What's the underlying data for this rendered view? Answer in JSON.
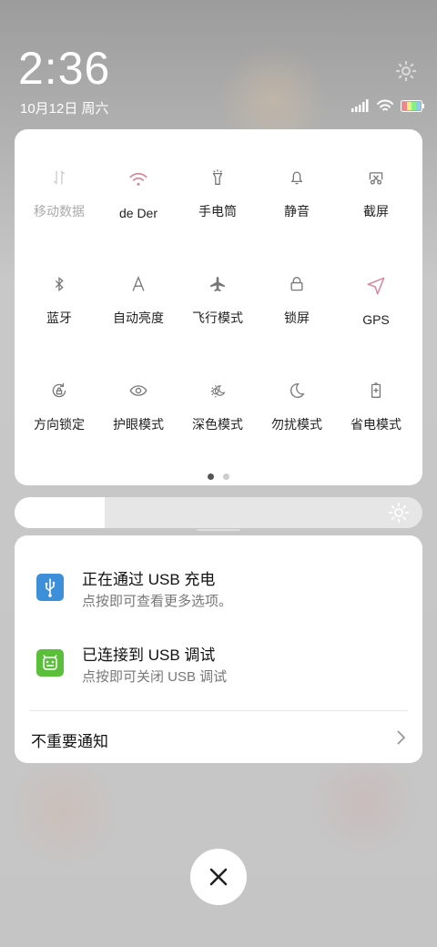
{
  "status": {
    "time": "2:36",
    "date": "10月12日 周六"
  },
  "quick_settings": {
    "tiles": [
      {
        "label": "移动数据",
        "icon": "mobile-data-icon",
        "state": "off"
      },
      {
        "label": "de     Der",
        "icon": "wifi-icon",
        "state": "on"
      },
      {
        "label": "手电筒",
        "icon": "flashlight-icon",
        "state": "off"
      },
      {
        "label": "静音",
        "icon": "bell-icon",
        "state": "off"
      },
      {
        "label": "截屏",
        "icon": "screenshot-icon",
        "state": "off"
      },
      {
        "label": "蓝牙",
        "icon": "bluetooth-icon",
        "state": "off"
      },
      {
        "label": "自动亮度",
        "icon": "auto-brightness-icon",
        "state": "off"
      },
      {
        "label": "飞行模式",
        "icon": "airplane-icon",
        "state": "off"
      },
      {
        "label": "锁屏",
        "icon": "lock-icon",
        "state": "off"
      },
      {
        "label": "GPS",
        "icon": "gps-icon",
        "state": "on"
      },
      {
        "label": "方向锁定",
        "icon": "rotation-lock-icon",
        "state": "off"
      },
      {
        "label": "护眼模式",
        "icon": "eye-icon",
        "state": "off"
      },
      {
        "label": "深色模式",
        "icon": "dark-mode-icon",
        "state": "off"
      },
      {
        "label": "勿扰模式",
        "icon": "moon-icon",
        "state": "off"
      },
      {
        "label": "省电模式",
        "icon": "battery-saver-icon",
        "state": "off"
      }
    ],
    "page_count": 2,
    "current_page": 1
  },
  "brightness": {
    "level": 0.22
  },
  "notifications": [
    {
      "title": "正在通过 USB 充电",
      "subtitle": "点按即可查看更多选项。",
      "icon": "usb-icon",
      "color": "#3d8fd9"
    },
    {
      "title": "已连接到 USB 调试",
      "subtitle": "点按即可关闭 USB 调试",
      "icon": "android-debug-icon",
      "color": "#5bbf3b"
    }
  ],
  "minor_notifications": {
    "label": "不重要通知"
  },
  "colors": {
    "accent_on": "#d88a9c",
    "icon_gray": "#777777"
  }
}
